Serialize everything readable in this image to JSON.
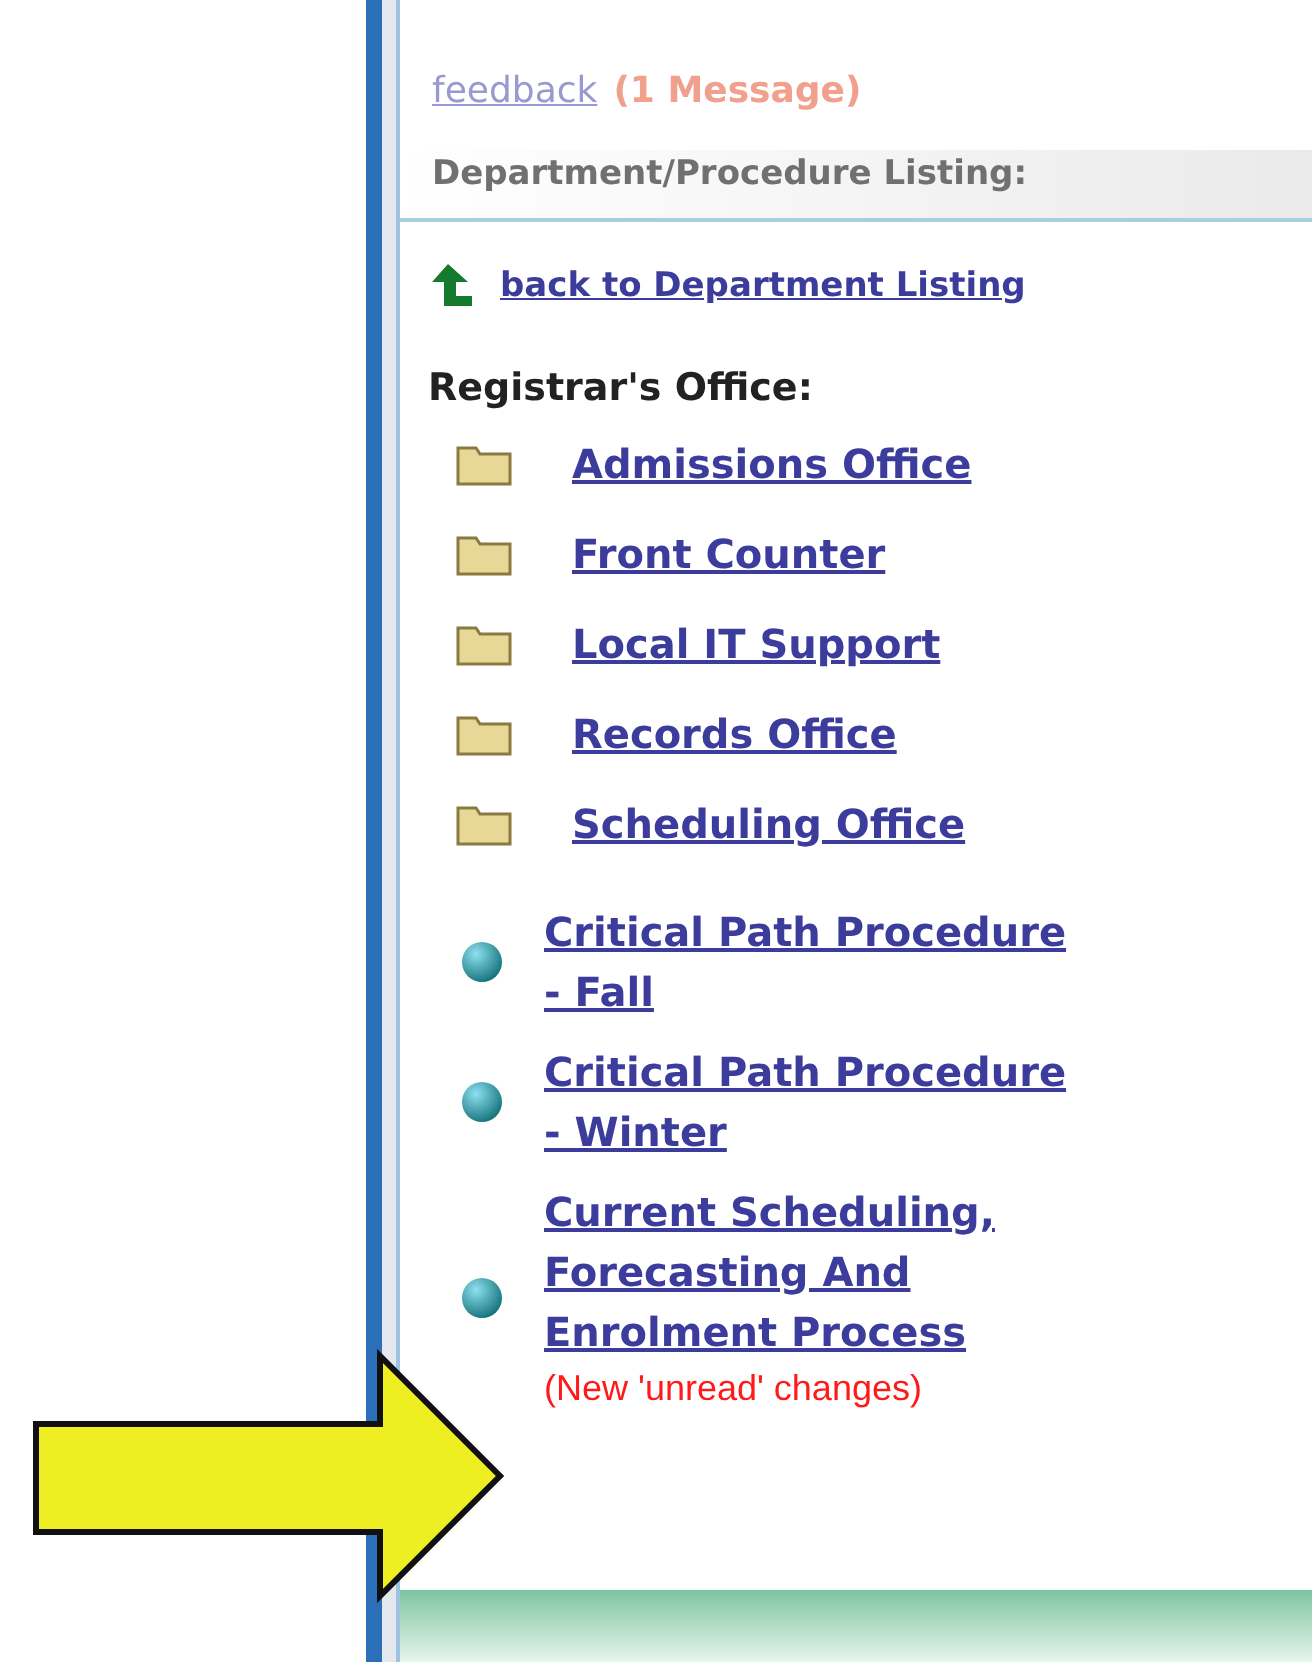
{
  "header": {
    "feedback_link": "feedback",
    "message_count": "(1 Message)"
  },
  "section_title": "Department/Procedure Listing:",
  "back_link": "back to Department Listing",
  "department": "Registrar's Office:",
  "folders": [
    {
      "label": "Admissions Office"
    },
    {
      "label": "Front Counter"
    },
    {
      "label": "Local IT Support"
    },
    {
      "label": "Records Office"
    },
    {
      "label": "Scheduling Office"
    }
  ],
  "procedures": [
    {
      "label": "Critical Path Procedure - Fall"
    },
    {
      "label": "Critical Path Procedure - Winter"
    },
    {
      "label": "Current Scheduling, Forecasting And Enrolment Process",
      "note": "(New 'unread' changes)"
    }
  ]
}
